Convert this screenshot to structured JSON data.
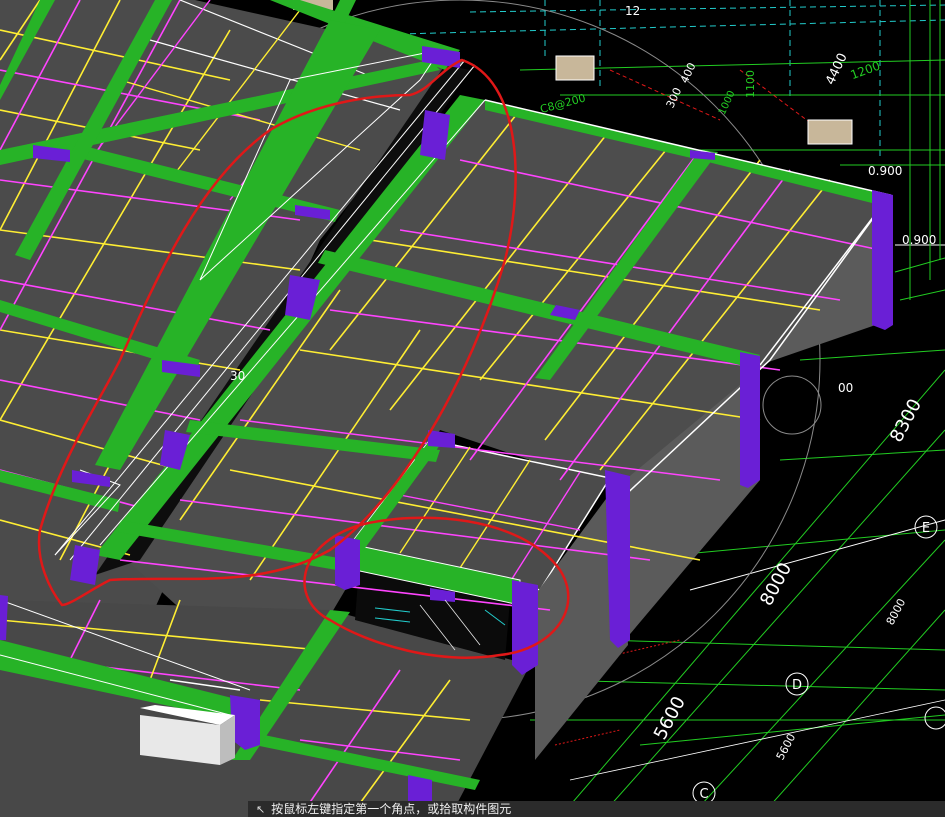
{
  "app": {
    "view": "3D model view"
  },
  "axis_labels": {
    "e": "E",
    "d": "D",
    "c": "C",
    "partial_top_a": "12"
  },
  "dimensions": {
    "d8300": "8300",
    "d8000": "8000",
    "d5600": "5600",
    "d4400": "4400",
    "d1200": "1200",
    "d1100": "1100",
    "d300": "300",
    "d400": "400",
    "d5600b": "5600",
    "d8000b": "8000",
    "level_0900a": "0.900",
    "level_0900b": "0.900",
    "d00": "00",
    "beam_lbl_a": "C8@200",
    "beam_lbl_b": "1000",
    "slab_num": "30"
  },
  "status": {
    "prompt": "按鼠标左键指定第一个角点，或拾取构件图元"
  },
  "colors": {
    "background": "#000000",
    "slab": "#4a4a4a",
    "wall": "#5a5a5a",
    "beam": "#27b327",
    "column": "#6a1fd6",
    "rebar_yellow": "#ffee33",
    "rebar_magenta": "#ff44ff",
    "annotation_red": "#e01818",
    "cad_green": "#22cc22",
    "cad_cyan": "#22cccc"
  }
}
